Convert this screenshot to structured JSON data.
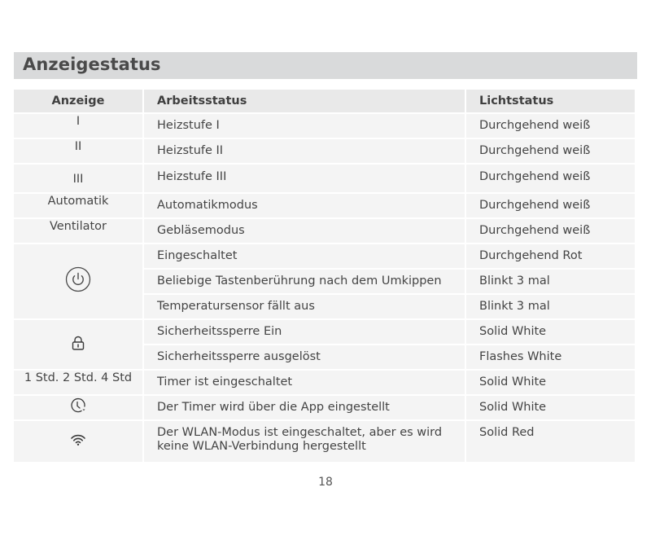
{
  "section": {
    "title": "Anzeigestatus"
  },
  "table": {
    "headers": {
      "anzeige": "Anzeige",
      "arbeitsstatus": "Arbeitsstatus",
      "lichtstatus": "Lichtstatus"
    },
    "rows": [
      {
        "anzeige": "I",
        "arbeitsstatus": "Heizstufe I",
        "lichtstatus": "Durchgehend weiß"
      },
      {
        "anzeige": "II",
        "arbeitsstatus": "Heizstufe II",
        "lichtstatus": "Durchgehend weiß"
      },
      {
        "anzeige": "III",
        "arbeitsstatus": "Heizstufe III",
        "lichtstatus": "Durchgehend weiß"
      },
      {
        "anzeige": "Automatik",
        "arbeitsstatus": "Automatikmodus",
        "lichtstatus": "Durchgehend weiß"
      },
      {
        "anzeige": "Ventilator",
        "arbeitsstatus": "Gebläsemodus",
        "lichtstatus": "Durchgehend weiß"
      },
      {
        "anzeige_icon": "power-icon",
        "arbeitsstatus": "Eingeschaltet",
        "lichtstatus": "Durchgehend Rot"
      },
      {
        "anzeige_icon": "power-icon",
        "arbeitsstatus": "Beliebige Tastenberührung nach dem Umkippen",
        "lichtstatus": "Blinkt 3 mal"
      },
      {
        "anzeige_icon": "power-icon",
        "arbeitsstatus": "Temperatursensor fällt aus",
        "lichtstatus": "Blinkt 3 mal"
      },
      {
        "anzeige_icon": "lock-icon",
        "arbeitsstatus": "Sicherheitssperre Ein",
        "lichtstatus": "Solid White"
      },
      {
        "anzeige_icon": "lock-icon",
        "arbeitsstatus": "Sicherheitssperre ausgelöst",
        "lichtstatus": "Flashes White"
      },
      {
        "anzeige": "1 Std. 2 Std. 4 Std",
        "arbeitsstatus": "Timer ist eingeschaltet",
        "lichtstatus": "Solid White"
      },
      {
        "anzeige_icon": "app-timer-icon",
        "arbeitsstatus": "Der Timer wird über die App eingestellt",
        "lichtstatus": "Solid White"
      },
      {
        "anzeige_icon": "wifi-icon",
        "arbeitsstatus": "Der WLAN-Modus ist eingeschaltet, aber es wird keine WLAN-Verbindung hergestellt",
        "lichtstatus": "Solid Red"
      }
    ]
  },
  "footer": {
    "page_number": "18"
  },
  "colors": {
    "title_bar": "#d9dadb",
    "header_cells": "#e9e9e9",
    "body_cells": "#f4f4f4",
    "text": "#444444"
  }
}
